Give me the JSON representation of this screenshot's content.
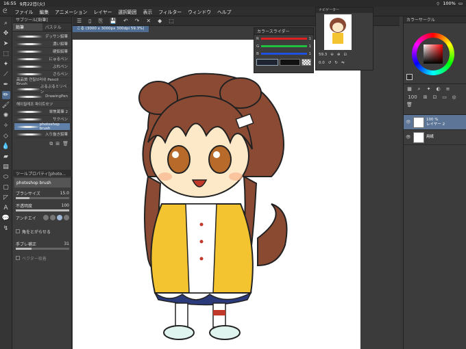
{
  "status": {
    "time": "16:55",
    "date": "9月22日(火)",
    "battery": "100%"
  },
  "menu": [
    "ファイル",
    "編集",
    "アニメーション",
    "レイヤー",
    "選択範囲",
    "表示",
    "フィルター",
    "ウィンドウ",
    "ヘルプ"
  ],
  "subtool": {
    "title": "サブツール[鉛筆]",
    "tabs": [
      "鉛筆",
      "パステル"
    ],
    "brushes": [
      "デッサン鉛筆",
      "濃い鉛筆",
      "硬鉛鉛筆",
      "にゅるペン",
      "ぶれペン",
      "さらペン",
      "高品質 연필브러쉬 Pencil Brush",
      "ぶるぶるミリペン",
      "DrawingPen",
      "해이필레조 파이트セツ",
      "単焦葛筆 2",
      "サクペン",
      "photoshop brush",
      "入り抜き鉛筆"
    ],
    "selected_index": 12
  },
  "toolprop": {
    "title": "ツールプロパティ[photo...",
    "brush_name": "photoshop brush",
    "size_label": "ブラシサイズ",
    "size_value": "15.0",
    "size_fill_pct": 25,
    "opacity_label": "不透明度",
    "opacity_value": "100",
    "opacity_fill_pct": 100,
    "aa_label": "アンチエイ",
    "corner_label": "角をとがらせる",
    "stabilizer_label": "手ブレ補正",
    "stabilizer_value": "31",
    "vector_label": "ベクター吸着"
  },
  "document": {
    "tab": "こる (3000 x 3000px 300dpi 59.3%)"
  },
  "navigator": {
    "title": "ナビゲーター",
    "zoom": "59.3",
    "rotation": "0.0"
  },
  "colorslider": {
    "title": "カラースライダー",
    "rows": [
      {
        "label": "R",
        "value": "1",
        "color": "#e02020"
      },
      {
        "label": "G",
        "value": "1",
        "color": "#20c040"
      },
      {
        "label": "B",
        "value": "1",
        "color": "#2050e0"
      }
    ]
  },
  "colorcircle": {
    "title": "カラーサークル"
  },
  "layers": {
    "opacity": "100",
    "items": [
      {
        "opacity": "100 %",
        "name": "レイヤー 2",
        "selected": true
      },
      {
        "opacity": "",
        "name": "用紙",
        "selected": false
      }
    ]
  }
}
